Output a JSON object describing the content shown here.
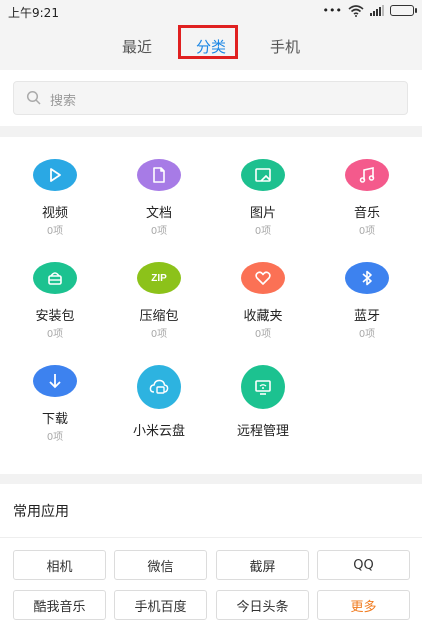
{
  "status_bar": {
    "time": "上午9:21",
    "dots": "•••"
  },
  "tabs": [
    {
      "label": "最近"
    },
    {
      "label": "分类",
      "active": true
    },
    {
      "label": "手机"
    }
  ],
  "search": {
    "placeholder": "搜索"
  },
  "categories": [
    {
      "label": "视频",
      "count": "0项",
      "icon": "play-icon",
      "color": "#2aa8e4"
    },
    {
      "label": "文档",
      "count": "0项",
      "icon": "document-icon",
      "color": "#a77be6"
    },
    {
      "label": "图片",
      "count": "0项",
      "icon": "image-icon",
      "color": "#1dc08f"
    },
    {
      "label": "音乐",
      "count": "0项",
      "icon": "music-icon",
      "color": "#f45a8c"
    },
    {
      "label": "安装包",
      "count": "0项",
      "icon": "android-icon",
      "color": "#1cc290"
    },
    {
      "label": "压缩包",
      "count": "0项",
      "icon": "zip-icon",
      "color": "#8cc21a",
      "icon_text": "ZIP"
    },
    {
      "label": "收藏夹",
      "count": "0项",
      "icon": "heart-icon",
      "color": "#fb7155"
    },
    {
      "label": "蓝牙",
      "count": "0项",
      "icon": "bluetooth-icon",
      "color": "#3d82ef"
    },
    {
      "label": "下载",
      "count": "0项",
      "icon": "download-icon",
      "color": "#3d82ef"
    },
    {
      "label": "小米云盘",
      "count": "",
      "icon": "cloud-icon",
      "color": "#2db3e0"
    },
    {
      "label": "远程管理",
      "count": "",
      "icon": "remote-icon",
      "color": "#1cc290"
    }
  ],
  "common_apps": {
    "title": "常用应用",
    "items": [
      {
        "label": "相机"
      },
      {
        "label": "微信"
      },
      {
        "label": "截屏"
      },
      {
        "label": "QQ"
      },
      {
        "label": "酷我音乐"
      },
      {
        "label": "手机百度"
      },
      {
        "label": "今日头条"
      },
      {
        "label": "更多",
        "highlight_color": "#f07b1f"
      }
    ]
  }
}
